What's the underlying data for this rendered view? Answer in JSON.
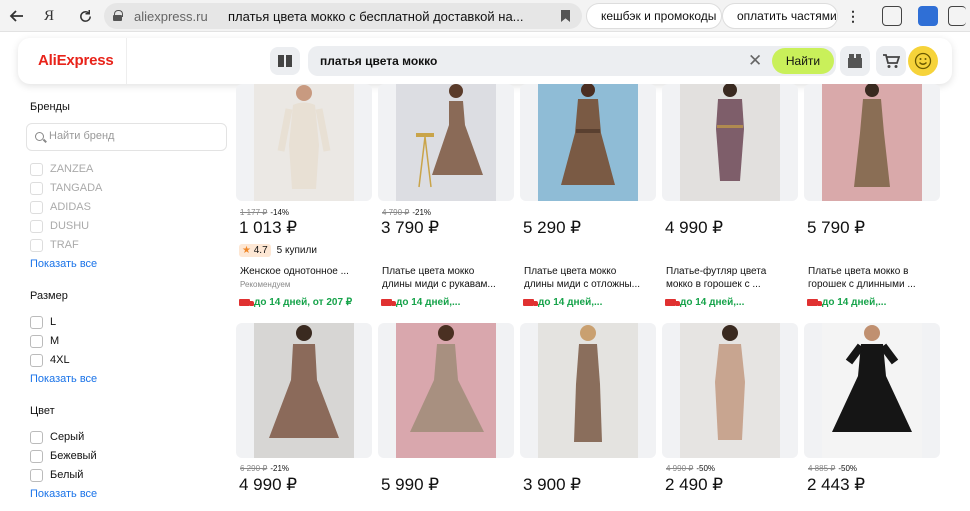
{
  "browser": {
    "domain": "aliexpress.ru",
    "page_title": "платья цвета мокко с бесплатной доставкой на...",
    "extensions": {
      "cashback": "кешбэк и промокоды",
      "installments": "оплатить частями"
    }
  },
  "header": {
    "logo": "AliExpress",
    "search_value": "платья цвета мокко",
    "search_button": "Найти"
  },
  "sidebar": {
    "brands_heading": "Бренды",
    "brand_search_placeholder": "Найти бренд",
    "brands": [
      "ZANZEA",
      "TANGADA",
      "ADIDAS",
      "DUSHU",
      "TRAF"
    ],
    "brands_show_all": "Показать все",
    "size_heading": "Размер",
    "sizes": [
      "L",
      "M",
      "4XL"
    ],
    "size_show_all": "Показать все",
    "color_heading": "Цвет",
    "colors": [
      "Серый",
      "Бежевый",
      "Белый"
    ],
    "color_show_all": "Показать все"
  },
  "products_row1": [
    {
      "old_price": "1 177 ₽",
      "discount": "-14%",
      "price": "1 013 ₽",
      "rating": "4.7",
      "bought": "5 купили",
      "title": "Женское однотонное ...",
      "note": "Рекомендуем",
      "delivery": "до 14 дней, от 207 ₽"
    },
    {
      "old_price": "4 790 ₽",
      "discount": "-21%",
      "price": "3 790 ₽",
      "title_l1": "Платье цвета мокко",
      "title_l2": "длины миди с рукавам...",
      "delivery": "до 14 дней,..."
    },
    {
      "price": "5 290 ₽",
      "title_l1": "Платье цвета мокко",
      "title_l2": "длины миди с отложны...",
      "delivery": "до 14 дней,..."
    },
    {
      "price": "4 990 ₽",
      "title_l1": "Платье-футляр цвета",
      "title_l2": "мокко в горошек с ...",
      "delivery": "до 14 дней,..."
    },
    {
      "price": "5 790 ₽",
      "title_l1": "Платье цвета мокко в",
      "title_l2": "горошек с длинными ...",
      "delivery": "до 14 дней,..."
    }
  ],
  "products_row2": [
    {
      "old_price": "6 290 ₽",
      "discount": "-21%",
      "price": "4 990 ₽"
    },
    {
      "price": "5 990 ₽"
    },
    {
      "price": "3 900 ₽"
    },
    {
      "old_price": "4 990 ₽",
      "discount": "-50%",
      "price": "2 490 ₽"
    },
    {
      "old_price": "4 885 ₽",
      "discount": "-50%",
      "price": "2 443 ₽"
    }
  ],
  "colors": {
    "brand_red": "#e8231a",
    "search_button": "#c9f05a",
    "link": "#1a73e8",
    "delivery_green": "#16a34a"
  },
  "icons": [
    "back-arrow-icon",
    "yandex-icon",
    "reload-icon",
    "lock-icon",
    "bookmark-icon",
    "menu-dots-icon",
    "catalog-icon",
    "clear-icon",
    "cart-icon",
    "coupon-icon",
    "profile-icon",
    "star-icon",
    "truck-icon",
    "search-icon"
  ]
}
